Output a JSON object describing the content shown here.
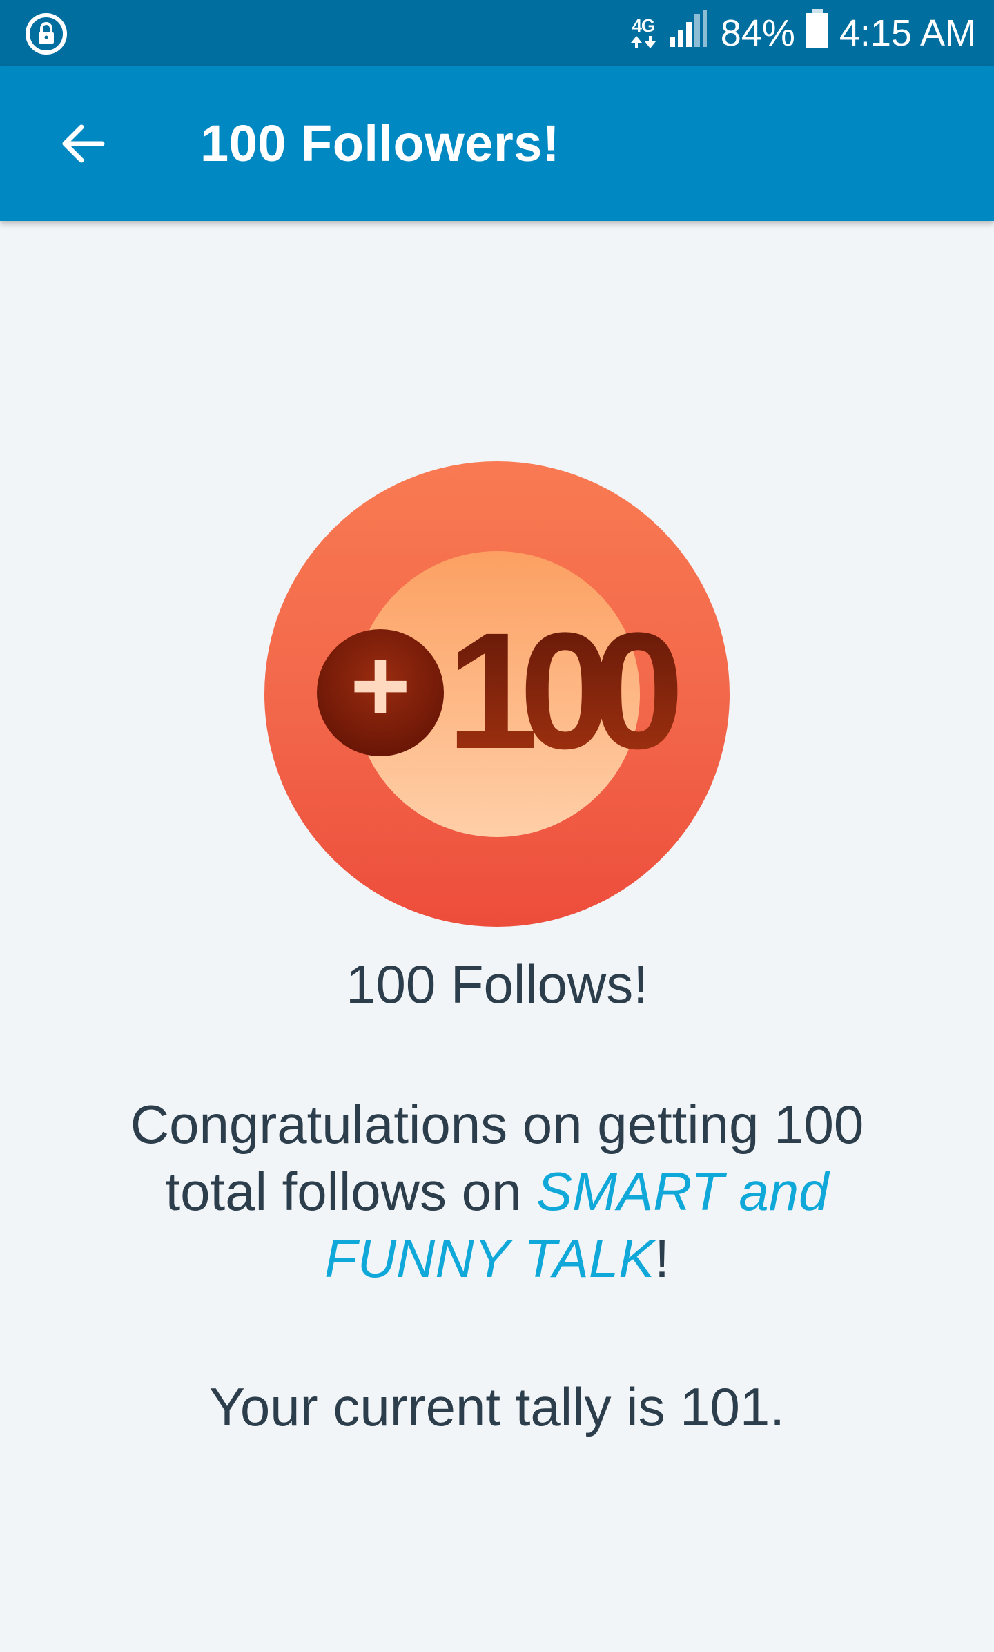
{
  "status_bar": {
    "lock_icon": "lock-circle-icon",
    "network_icon": "lte-4g-icon",
    "network_text": "4G",
    "signal_icon": "signal-bars-icon",
    "battery_percent": "84%",
    "battery_icon": "battery-icon",
    "time": "4:15 AM"
  },
  "app_bar": {
    "back_icon": "arrow-back-icon",
    "title": "100 Followers!"
  },
  "badge": {
    "icon": "plus-100-icon",
    "plus_text": "+",
    "number_text": "100",
    "colors": {
      "outer_ring": "#f2664a",
      "inner_disc": "#fdb98c",
      "plus_circle": "#9b2a10",
      "number": "#7a2008"
    }
  },
  "main": {
    "achievement_title": "100 Follows!",
    "congrats_before": "Congratulations on getting 100 total follows on ",
    "site_name": "SMART and FUNNY TALK",
    "congrats_after": "!",
    "tally_text": "Your current tally is 101."
  },
  "colors": {
    "status_bar": "#006e9f",
    "app_bar": "#0088c2",
    "background": "#f2f5f8",
    "body_text": "#2c3d4c",
    "link": "#10a8d8"
  }
}
